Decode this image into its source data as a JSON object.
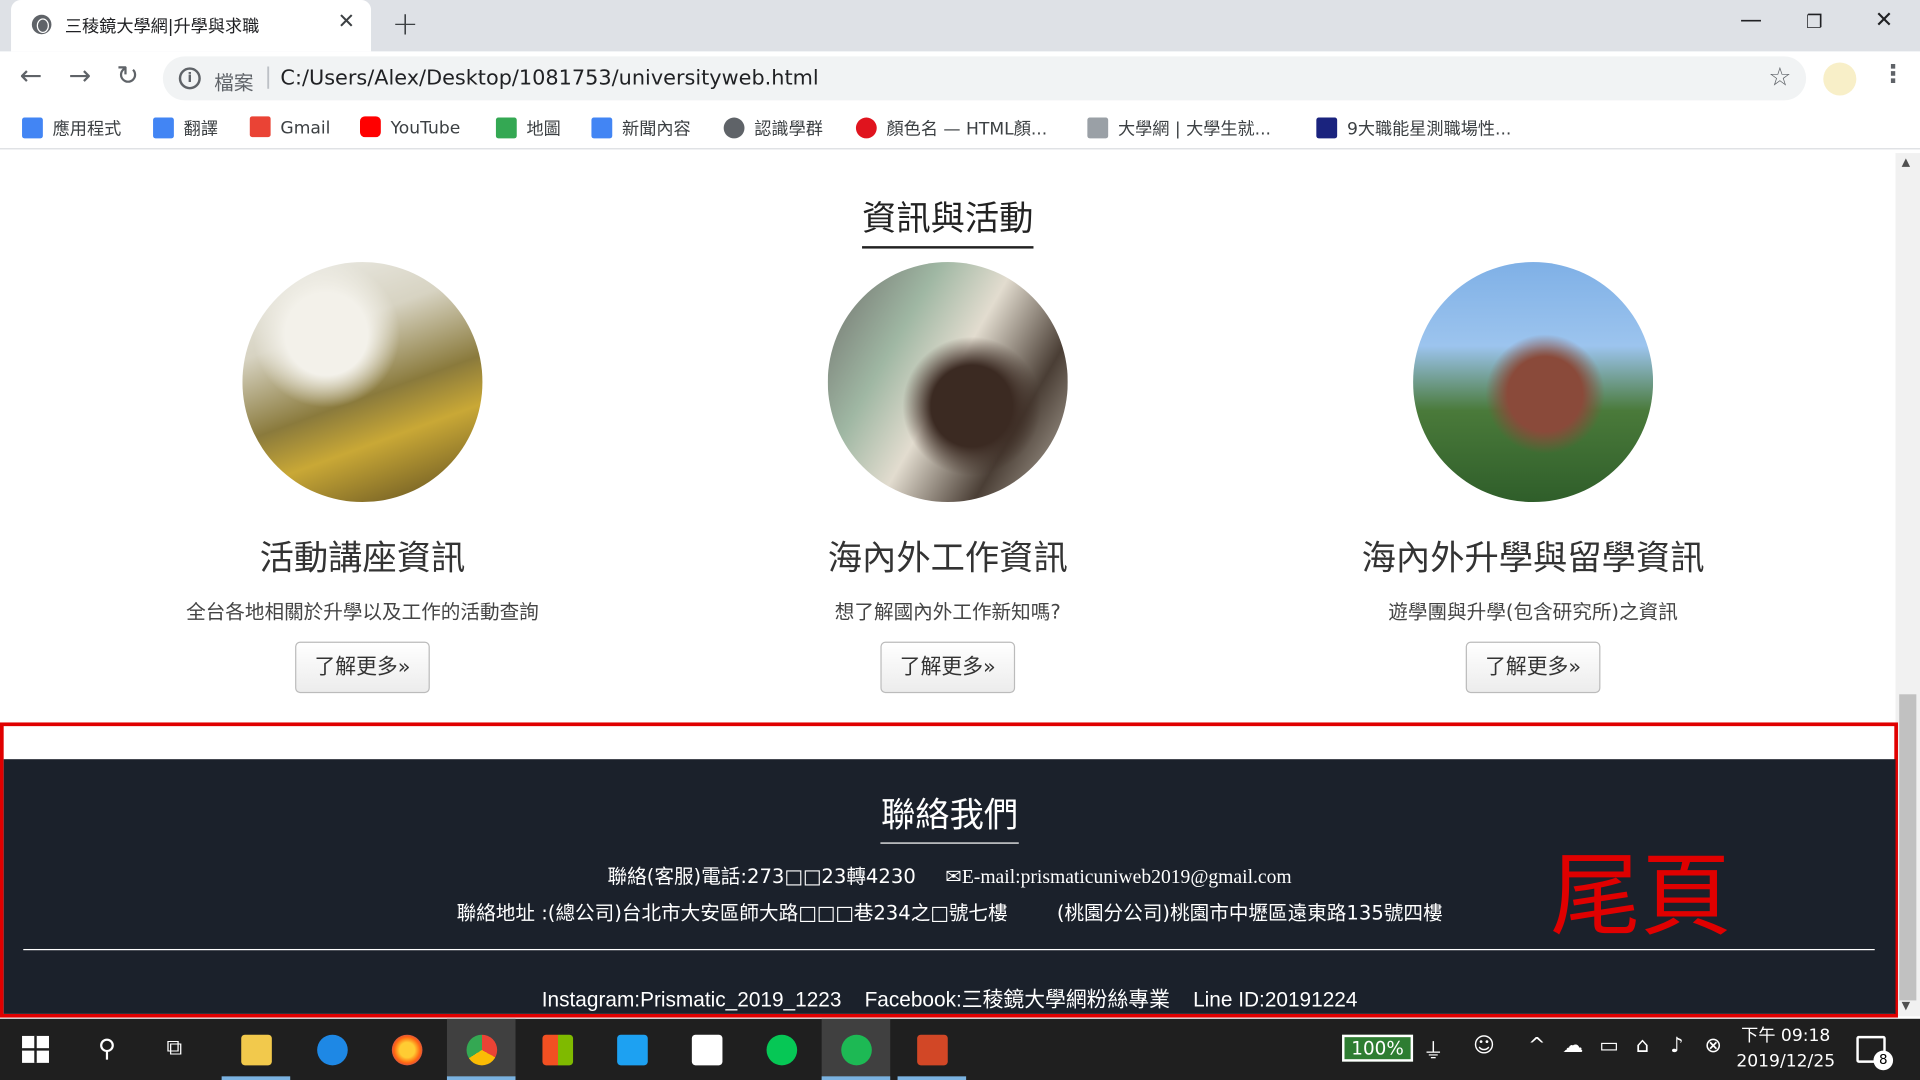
{
  "browser": {
    "tab_title": "三稜鏡大學網|升學與求職",
    "url_scheme": "檔案",
    "url": "C:/Users/Alex/Desktop/1081753/universityweb.html"
  },
  "bookmarks": [
    {
      "label": "應用程式",
      "icon": "apps-grid-icon",
      "color": "#4285f4"
    },
    {
      "label": "翻譯",
      "icon": "translate-icon",
      "color": "#4285f4"
    },
    {
      "label": "Gmail",
      "icon": "gmail-icon",
      "color": "#ea4335"
    },
    {
      "label": "YouTube",
      "icon": "youtube-icon",
      "color": "#ff0000"
    },
    {
      "label": "地圖",
      "icon": "maps-icon",
      "color": "#34a853"
    },
    {
      "label": "新聞內容",
      "icon": "news-icon",
      "color": "#4285f4"
    },
    {
      "label": "認識學群",
      "icon": "globe-icon",
      "color": "#5f6368"
    },
    {
      "label": "顏色名 — HTML顏...",
      "icon": "opera-icon",
      "color": "#e0141e"
    },
    {
      "label": "大學網 | 大學生就...",
      "icon": "page-icon",
      "color": "#9aa0a6"
    },
    {
      "label": "9大職能星測職場性...",
      "icon": "gv-icon",
      "color": "#1a237e"
    }
  ],
  "section": {
    "title": "資訊與活動",
    "columns": [
      {
        "heading": "活動講座資訊",
        "desc": "全台各地相關於升學以及工作的活動查詢",
        "button": "了解更多»"
      },
      {
        "heading": "海內外工作資訊",
        "desc": "想了解國內外工作新知嗎?",
        "button": "了解更多»"
      },
      {
        "heading": "海內外升學與留學資訊",
        "desc": "遊學團與升學(包含研究所)之資訊",
        "button": "了解更多»"
      }
    ]
  },
  "footer": {
    "title": "聯絡我們",
    "phone": "聯絡(客服)電話:273□□23轉4230",
    "email": "E-mail:prismaticuniweb2019@gmail.com",
    "address_hq": "聯絡地址 :(總公司)台北市大安區師大路□□□巷234之□號七樓",
    "address_branch": "(桃園分公司)桃園市中壢區遠東路135號四樓",
    "social": "Instagram:Prismatic_2019_1223    Facebook:三稜鏡大學網粉絲專業    Line ID:20191224",
    "annotation": "尾頁"
  },
  "taskbar": {
    "battery": "100%",
    "time": "下午 09:18",
    "date": "2019/12/25",
    "notifications": "8"
  }
}
